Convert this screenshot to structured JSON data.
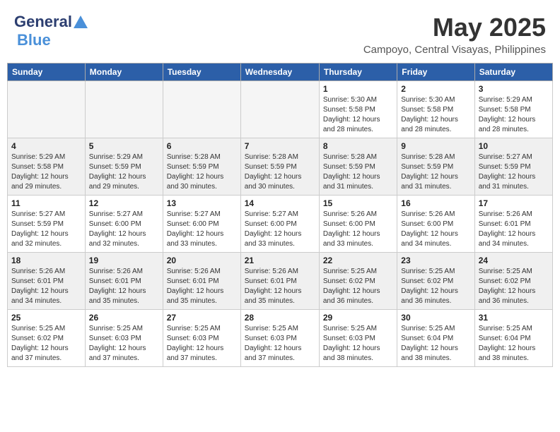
{
  "logo": {
    "general": "General",
    "blue": "Blue"
  },
  "title": "May 2025",
  "location": "Campoyo, Central Visayas, Philippines",
  "days_header": [
    "Sunday",
    "Monday",
    "Tuesday",
    "Wednesday",
    "Thursday",
    "Friday",
    "Saturday"
  ],
  "weeks": [
    [
      {
        "day": "",
        "info": ""
      },
      {
        "day": "",
        "info": ""
      },
      {
        "day": "",
        "info": ""
      },
      {
        "day": "",
        "info": ""
      },
      {
        "day": "1",
        "info": "Sunrise: 5:30 AM\nSunset: 5:58 PM\nDaylight: 12 hours\nand 28 minutes."
      },
      {
        "day": "2",
        "info": "Sunrise: 5:30 AM\nSunset: 5:58 PM\nDaylight: 12 hours\nand 28 minutes."
      },
      {
        "day": "3",
        "info": "Sunrise: 5:29 AM\nSunset: 5:58 PM\nDaylight: 12 hours\nand 28 minutes."
      }
    ],
    [
      {
        "day": "4",
        "info": "Sunrise: 5:29 AM\nSunset: 5:58 PM\nDaylight: 12 hours\nand 29 minutes."
      },
      {
        "day": "5",
        "info": "Sunrise: 5:29 AM\nSunset: 5:59 PM\nDaylight: 12 hours\nand 29 minutes."
      },
      {
        "day": "6",
        "info": "Sunrise: 5:28 AM\nSunset: 5:59 PM\nDaylight: 12 hours\nand 30 minutes."
      },
      {
        "day": "7",
        "info": "Sunrise: 5:28 AM\nSunset: 5:59 PM\nDaylight: 12 hours\nand 30 minutes."
      },
      {
        "day": "8",
        "info": "Sunrise: 5:28 AM\nSunset: 5:59 PM\nDaylight: 12 hours\nand 31 minutes."
      },
      {
        "day": "9",
        "info": "Sunrise: 5:28 AM\nSunset: 5:59 PM\nDaylight: 12 hours\nand 31 minutes."
      },
      {
        "day": "10",
        "info": "Sunrise: 5:27 AM\nSunset: 5:59 PM\nDaylight: 12 hours\nand 31 minutes."
      }
    ],
    [
      {
        "day": "11",
        "info": "Sunrise: 5:27 AM\nSunset: 5:59 PM\nDaylight: 12 hours\nand 32 minutes."
      },
      {
        "day": "12",
        "info": "Sunrise: 5:27 AM\nSunset: 6:00 PM\nDaylight: 12 hours\nand 32 minutes."
      },
      {
        "day": "13",
        "info": "Sunrise: 5:27 AM\nSunset: 6:00 PM\nDaylight: 12 hours\nand 33 minutes."
      },
      {
        "day": "14",
        "info": "Sunrise: 5:27 AM\nSunset: 6:00 PM\nDaylight: 12 hours\nand 33 minutes."
      },
      {
        "day": "15",
        "info": "Sunrise: 5:26 AM\nSunset: 6:00 PM\nDaylight: 12 hours\nand 33 minutes."
      },
      {
        "day": "16",
        "info": "Sunrise: 5:26 AM\nSunset: 6:00 PM\nDaylight: 12 hours\nand 34 minutes."
      },
      {
        "day": "17",
        "info": "Sunrise: 5:26 AM\nSunset: 6:01 PM\nDaylight: 12 hours\nand 34 minutes."
      }
    ],
    [
      {
        "day": "18",
        "info": "Sunrise: 5:26 AM\nSunset: 6:01 PM\nDaylight: 12 hours\nand 34 minutes."
      },
      {
        "day": "19",
        "info": "Sunrise: 5:26 AM\nSunset: 6:01 PM\nDaylight: 12 hours\nand 35 minutes."
      },
      {
        "day": "20",
        "info": "Sunrise: 5:26 AM\nSunset: 6:01 PM\nDaylight: 12 hours\nand 35 minutes."
      },
      {
        "day": "21",
        "info": "Sunrise: 5:26 AM\nSunset: 6:01 PM\nDaylight: 12 hours\nand 35 minutes."
      },
      {
        "day": "22",
        "info": "Sunrise: 5:25 AM\nSunset: 6:02 PM\nDaylight: 12 hours\nand 36 minutes."
      },
      {
        "day": "23",
        "info": "Sunrise: 5:25 AM\nSunset: 6:02 PM\nDaylight: 12 hours\nand 36 minutes."
      },
      {
        "day": "24",
        "info": "Sunrise: 5:25 AM\nSunset: 6:02 PM\nDaylight: 12 hours\nand 36 minutes."
      }
    ],
    [
      {
        "day": "25",
        "info": "Sunrise: 5:25 AM\nSunset: 6:02 PM\nDaylight: 12 hours\nand 37 minutes."
      },
      {
        "day": "26",
        "info": "Sunrise: 5:25 AM\nSunset: 6:03 PM\nDaylight: 12 hours\nand 37 minutes."
      },
      {
        "day": "27",
        "info": "Sunrise: 5:25 AM\nSunset: 6:03 PM\nDaylight: 12 hours\nand 37 minutes."
      },
      {
        "day": "28",
        "info": "Sunrise: 5:25 AM\nSunset: 6:03 PM\nDaylight: 12 hours\nand 37 minutes."
      },
      {
        "day": "29",
        "info": "Sunrise: 5:25 AM\nSunset: 6:03 PM\nDaylight: 12 hours\nand 38 minutes."
      },
      {
        "day": "30",
        "info": "Sunrise: 5:25 AM\nSunset: 6:04 PM\nDaylight: 12 hours\nand 38 minutes."
      },
      {
        "day": "31",
        "info": "Sunrise: 5:25 AM\nSunset: 6:04 PM\nDaylight: 12 hours\nand 38 minutes."
      }
    ]
  ]
}
